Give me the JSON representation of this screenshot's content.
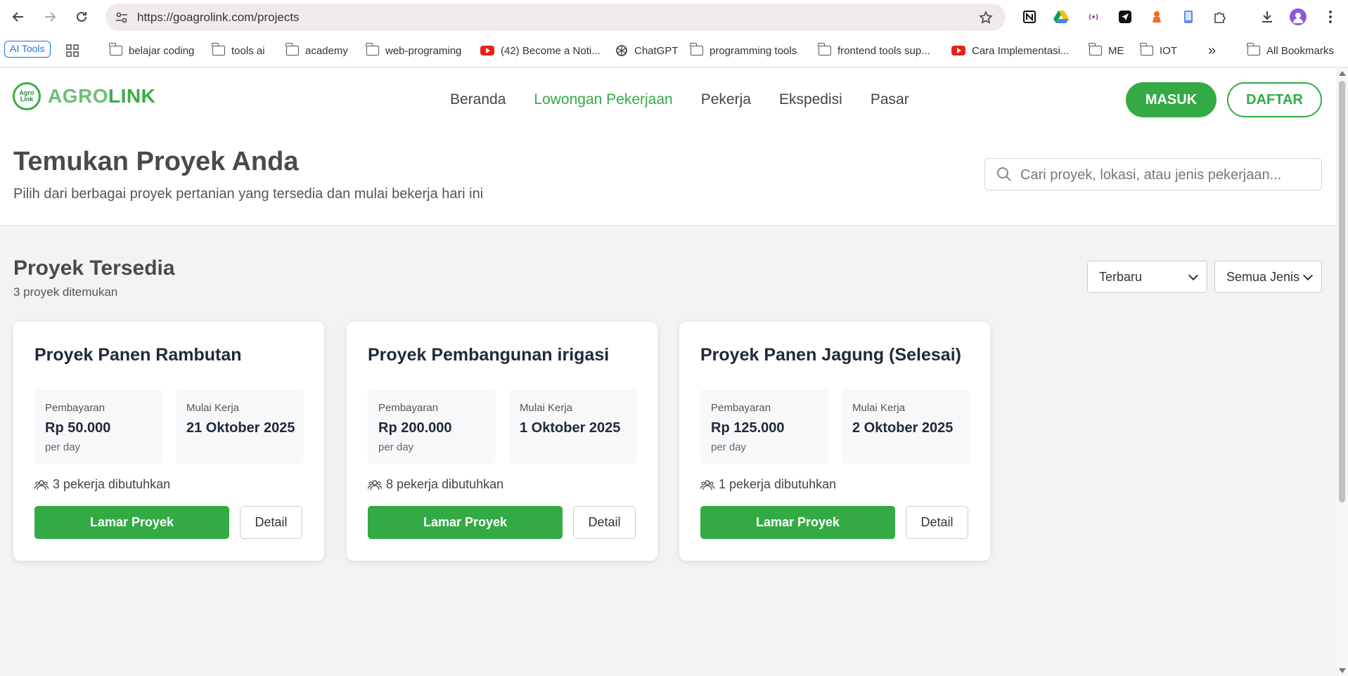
{
  "browser": {
    "url": "https://goagrolink.com/projects",
    "bookmarks": [
      {
        "label": "AI Tools",
        "type": "badge"
      },
      {
        "label": "belajar coding",
        "type": "folder"
      },
      {
        "label": "tools ai",
        "type": "folder"
      },
      {
        "label": "academy",
        "type": "folder"
      },
      {
        "label": "web-programing",
        "type": "folder"
      },
      {
        "label": "(42) Become a Noti...",
        "type": "youtube"
      },
      {
        "label": "ChatGPT",
        "type": "chatgpt"
      },
      {
        "label": "programming tools",
        "type": "folder"
      },
      {
        "label": "frontend tools sup...",
        "type": "folder"
      },
      {
        "label": "Cara Implementasi...",
        "type": "youtube"
      },
      {
        "label": "ME",
        "type": "folder"
      },
      {
        "label": "IOT",
        "type": "folder"
      },
      {
        "label": "All Bookmarks",
        "type": "folder"
      }
    ],
    "more": "»"
  },
  "brand": {
    "logo_text": "Agro Link",
    "name_part1": "AGRO",
    "name_part2": "LINK",
    "color": "#3cab45"
  },
  "nav": {
    "items": [
      "Beranda",
      "Lowongan Pekerjaan",
      "Pekerja",
      "Ekspedisi",
      "Pasar"
    ],
    "active_index": 1
  },
  "auth": {
    "login": "MASUK",
    "register": "DAFTAR"
  },
  "hero": {
    "title": "Temukan Proyek Anda",
    "subtitle": "Pilih dari berbagai proyek pertanian yang tersedia dan mulai bekerja hari ini",
    "search_placeholder": "Cari proyek, lokasi, atau jenis pekerjaan..."
  },
  "listing": {
    "title": "Proyek Tersedia",
    "count": "3 proyek ditemukan",
    "sort_value": "Terbaru",
    "type_value": "Semua Jenis"
  },
  "projects": [
    {
      "title": "Proyek Panen Rambutan",
      "pay_label": "Pembayaran",
      "pay": "Rp 50.000",
      "pay_unit": "per day",
      "start_label": "Mulai Kerja",
      "start": "21 Oktober 2025",
      "workers": "3 pekerja dibutuhkan",
      "apply": "Lamar Proyek",
      "detail": "Detail"
    },
    {
      "title": "Proyek Pembangunan irigasi",
      "pay_label": "Pembayaran",
      "pay": "Rp 200.000",
      "pay_unit": "per day",
      "start_label": "Mulai Kerja",
      "start": "1 Oktober 2025",
      "workers": "8 pekerja dibutuhkan",
      "apply": "Lamar Proyek",
      "detail": "Detail"
    },
    {
      "title": "Proyek Panen Jagung (Selesai)",
      "pay_label": "Pembayaran",
      "pay": "Rp 125.000",
      "pay_unit": "per day",
      "start_label": "Mulai Kerja",
      "start": "2 Oktober 2025",
      "workers": "1 pekerja dibutuhkan",
      "apply": "Lamar Proyek",
      "detail": "Detail"
    }
  ],
  "colors": {
    "primary": "#34aa45",
    "heading": "#1f2a3a"
  }
}
